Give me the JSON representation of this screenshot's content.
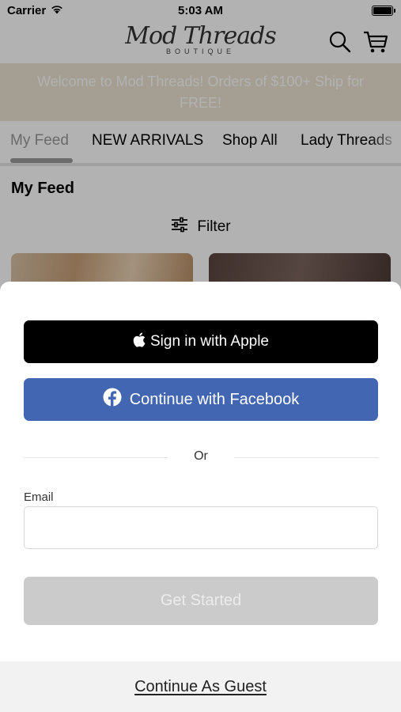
{
  "status_bar": {
    "carrier": "Carrier",
    "time": "5:03 AM"
  },
  "header": {
    "logo_script": "Mod Threads",
    "logo_subtitle": "BOUTIQUE"
  },
  "banner": {
    "text": "Welcome to Mod Threads! Orders of $100+ Ship for FREE!"
  },
  "tabs": [
    {
      "label": "My Feed",
      "active": true
    },
    {
      "label": "NEW ARRIVALS",
      "active": false
    },
    {
      "label": "Shop All",
      "active": false
    },
    {
      "label": "Lady Threads",
      "active": false
    }
  ],
  "feed": {
    "title": "My Feed",
    "filter_label": "Filter"
  },
  "login_sheet": {
    "apple_button": "Sign in with Apple",
    "facebook_button": "Continue with Facebook",
    "divider_text": "Or",
    "email_label": "Email",
    "email_value": "",
    "email_placeholder": "",
    "submit_button": "Get Started",
    "guest_link": "Continue As Guest"
  },
  "colors": {
    "facebook_blue": "#4266b2",
    "apple_black": "#000000",
    "banner_bg": "#ece3d1",
    "disabled_button": "#cbcbcb"
  }
}
